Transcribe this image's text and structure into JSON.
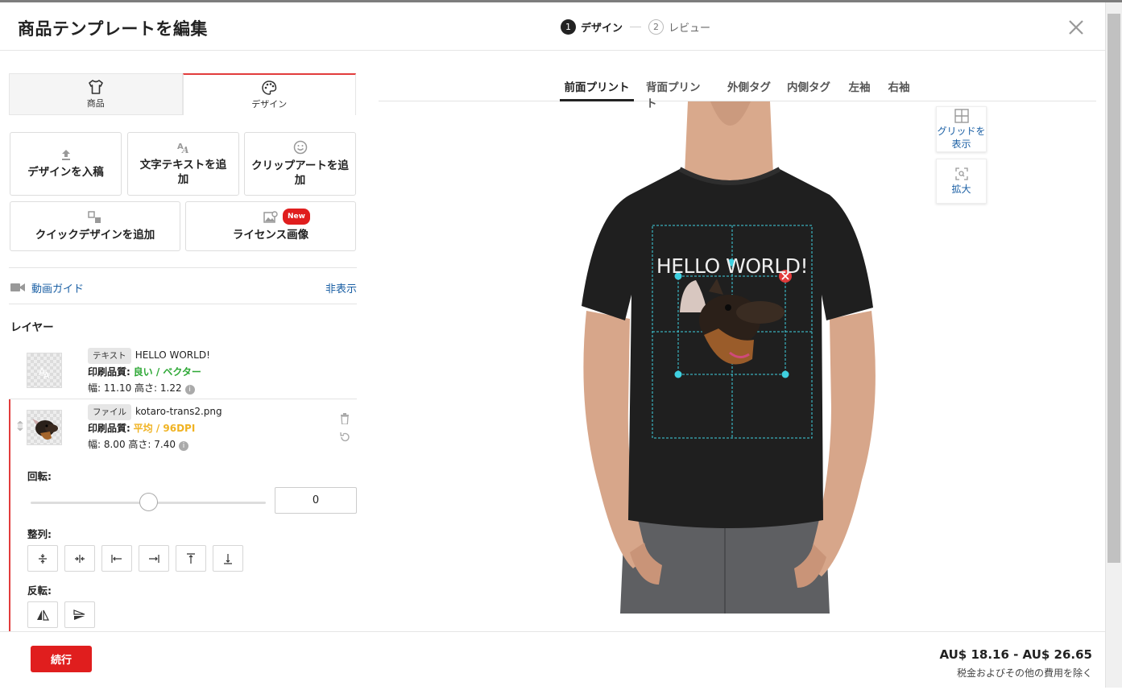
{
  "header": {
    "title": "商品テンプレートを編集",
    "steps": [
      {
        "num": "1",
        "label": "デザイン"
      },
      {
        "num": "2",
        "label": "レビュー"
      }
    ]
  },
  "left_tabs": [
    {
      "label": "商品",
      "icon": "tshirt-icon"
    },
    {
      "label": "デザイン",
      "icon": "palette-icon"
    }
  ],
  "tools": {
    "upload": "デザインを入稿",
    "add_text": "文字テキストを追加",
    "add_clipart": "クリップアートを追加",
    "quick_design": "クイックデザインを追加",
    "licensed_image": "ライセンス画像",
    "new_badge": "New"
  },
  "guide": {
    "label": "動画ガイド",
    "hide": "非表示"
  },
  "layers": {
    "title": "レイヤー",
    "items": [
      {
        "tag": "テキスト",
        "name": "HELLO WORLD!",
        "quality_label": "印刷品質:",
        "quality": "良い / ベクター",
        "dims": "幅: 11.10 高さ: 1.22"
      },
      {
        "tag": "ファイル",
        "name": "kotaro-trans2.png",
        "quality_label": "印刷品質:",
        "quality": "平均 / 96DPI",
        "dims": "幅: 8.00 高さ: 7.40"
      }
    ]
  },
  "controls": {
    "rotation_label": "回転:",
    "rotation_value": "0",
    "rotation_slider_fraction": 0.5,
    "align_label": "整列:",
    "flip_label": "反転:"
  },
  "print_tabs": [
    "前面プリント",
    "背面プリント",
    "外側タグ",
    "内側タグ",
    "左袖",
    "右袖"
  ],
  "canvas": {
    "design_text": "HELLO WORLD!"
  },
  "side_tools": {
    "grid": "グリッドを表示",
    "zoom": "拡大"
  },
  "footer": {
    "continue": "続行",
    "price": "AU$ 18.16 - AU$ 26.65",
    "note": "税金およびその他の費用を除く"
  },
  "colors": {
    "accent": "#e01e1e",
    "link": "#1a5fa4",
    "good": "#2ea836",
    "average": "#f0b323",
    "guide": "#3fd0e0"
  }
}
